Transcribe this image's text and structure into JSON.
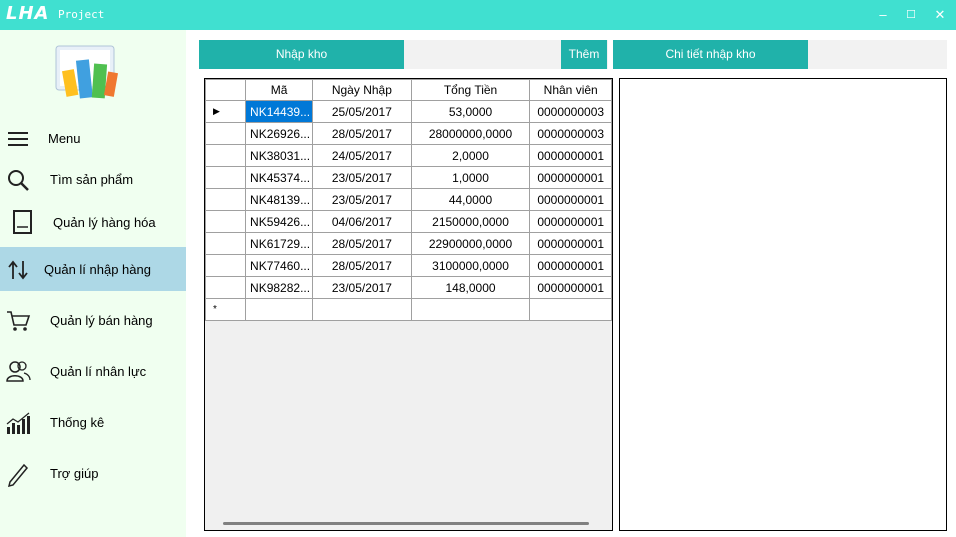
{
  "window": {
    "logo_text": "LHA",
    "subtitle": "Project",
    "min_label": "–",
    "max_label": "☐",
    "close_label": "✕"
  },
  "sidebar": {
    "items": [
      {
        "label": "Menu",
        "icon": "hamburger-icon"
      },
      {
        "label": "Tìm sản phẩm",
        "icon": "search-icon"
      },
      {
        "label": "Quản lý hàng hóa",
        "icon": "book-icon"
      },
      {
        "label": "Quản lí nhập hàng",
        "icon": "sync-arrows-icon",
        "active": true
      },
      {
        "label": "Quản lý bán hàng",
        "icon": "cart-icon"
      },
      {
        "label": "Quản lí nhân lực",
        "icon": "users-icon"
      },
      {
        "label": "Thống kê",
        "icon": "bar-chart-icon"
      },
      {
        "label": "Trợ giúp",
        "icon": "pencil-icon"
      }
    ]
  },
  "toolbar": {
    "import_label": "Nhập kho",
    "add_label": "Thêm",
    "detail_label": "Chi tiết nhập kho"
  },
  "grid": {
    "columns": [
      "Mã",
      "Ngày Nhập",
      "Tổng Tiền",
      "Nhân viên"
    ],
    "rows": [
      [
        "NK14439...",
        "25/05/2017",
        "53,0000",
        "0000000003"
      ],
      [
        "NK26926...",
        "28/05/2017",
        "28000000,0000",
        "0000000003"
      ],
      [
        "NK38031...",
        "24/05/2017",
        "2,0000",
        "0000000001"
      ],
      [
        "NK45374...",
        "23/05/2017",
        "1,0000",
        "0000000001"
      ],
      [
        "NK48139...",
        "23/05/2017",
        "44,0000",
        "0000000001"
      ],
      [
        "NK59426...",
        "04/06/2017",
        "2150000,0000",
        "0000000001"
      ],
      [
        "NK61729...",
        "28/05/2017",
        "22900000,0000",
        "0000000001"
      ],
      [
        "NK77460...",
        "28/05/2017",
        "3100000,0000",
        "0000000001"
      ],
      [
        "NK98282...",
        "23/05/2017",
        "148,0000",
        "0000000001"
      ]
    ],
    "current_row_marker": "▶",
    "new_row_marker": "*"
  },
  "colors": {
    "titlebar": "#40e0d0",
    "sidebar_bg": "#f0fff0",
    "active_item": "#add8e6",
    "button": "#20b2aa",
    "selection": "#0078d7"
  }
}
